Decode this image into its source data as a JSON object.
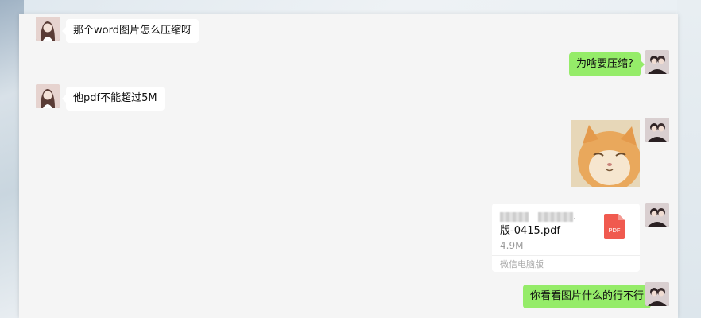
{
  "messages": [
    {
      "side": "left",
      "text": "那个word图片怎么压缩呀"
    },
    {
      "side": "right",
      "text": "为啥要压缩?"
    },
    {
      "side": "left",
      "text": "他pdf不能超过5M"
    },
    {
      "side": "right",
      "type": "image",
      "icon": "cat-sticker"
    },
    {
      "side": "right",
      "type": "file",
      "file_name_visible": "版-0415.pdf",
      "file_size": "4.9M",
      "source": "微信电脑版",
      "icon_label": "PDF"
    },
    {
      "side": "right",
      "text": "你看看图片什么的行不行"
    }
  ],
  "colors": {
    "sent_bubble": "#95ec69",
    "received_bubble": "#ffffff",
    "chat_bg": "#f5f5f5",
    "pdf_red": "#f05a4f"
  }
}
